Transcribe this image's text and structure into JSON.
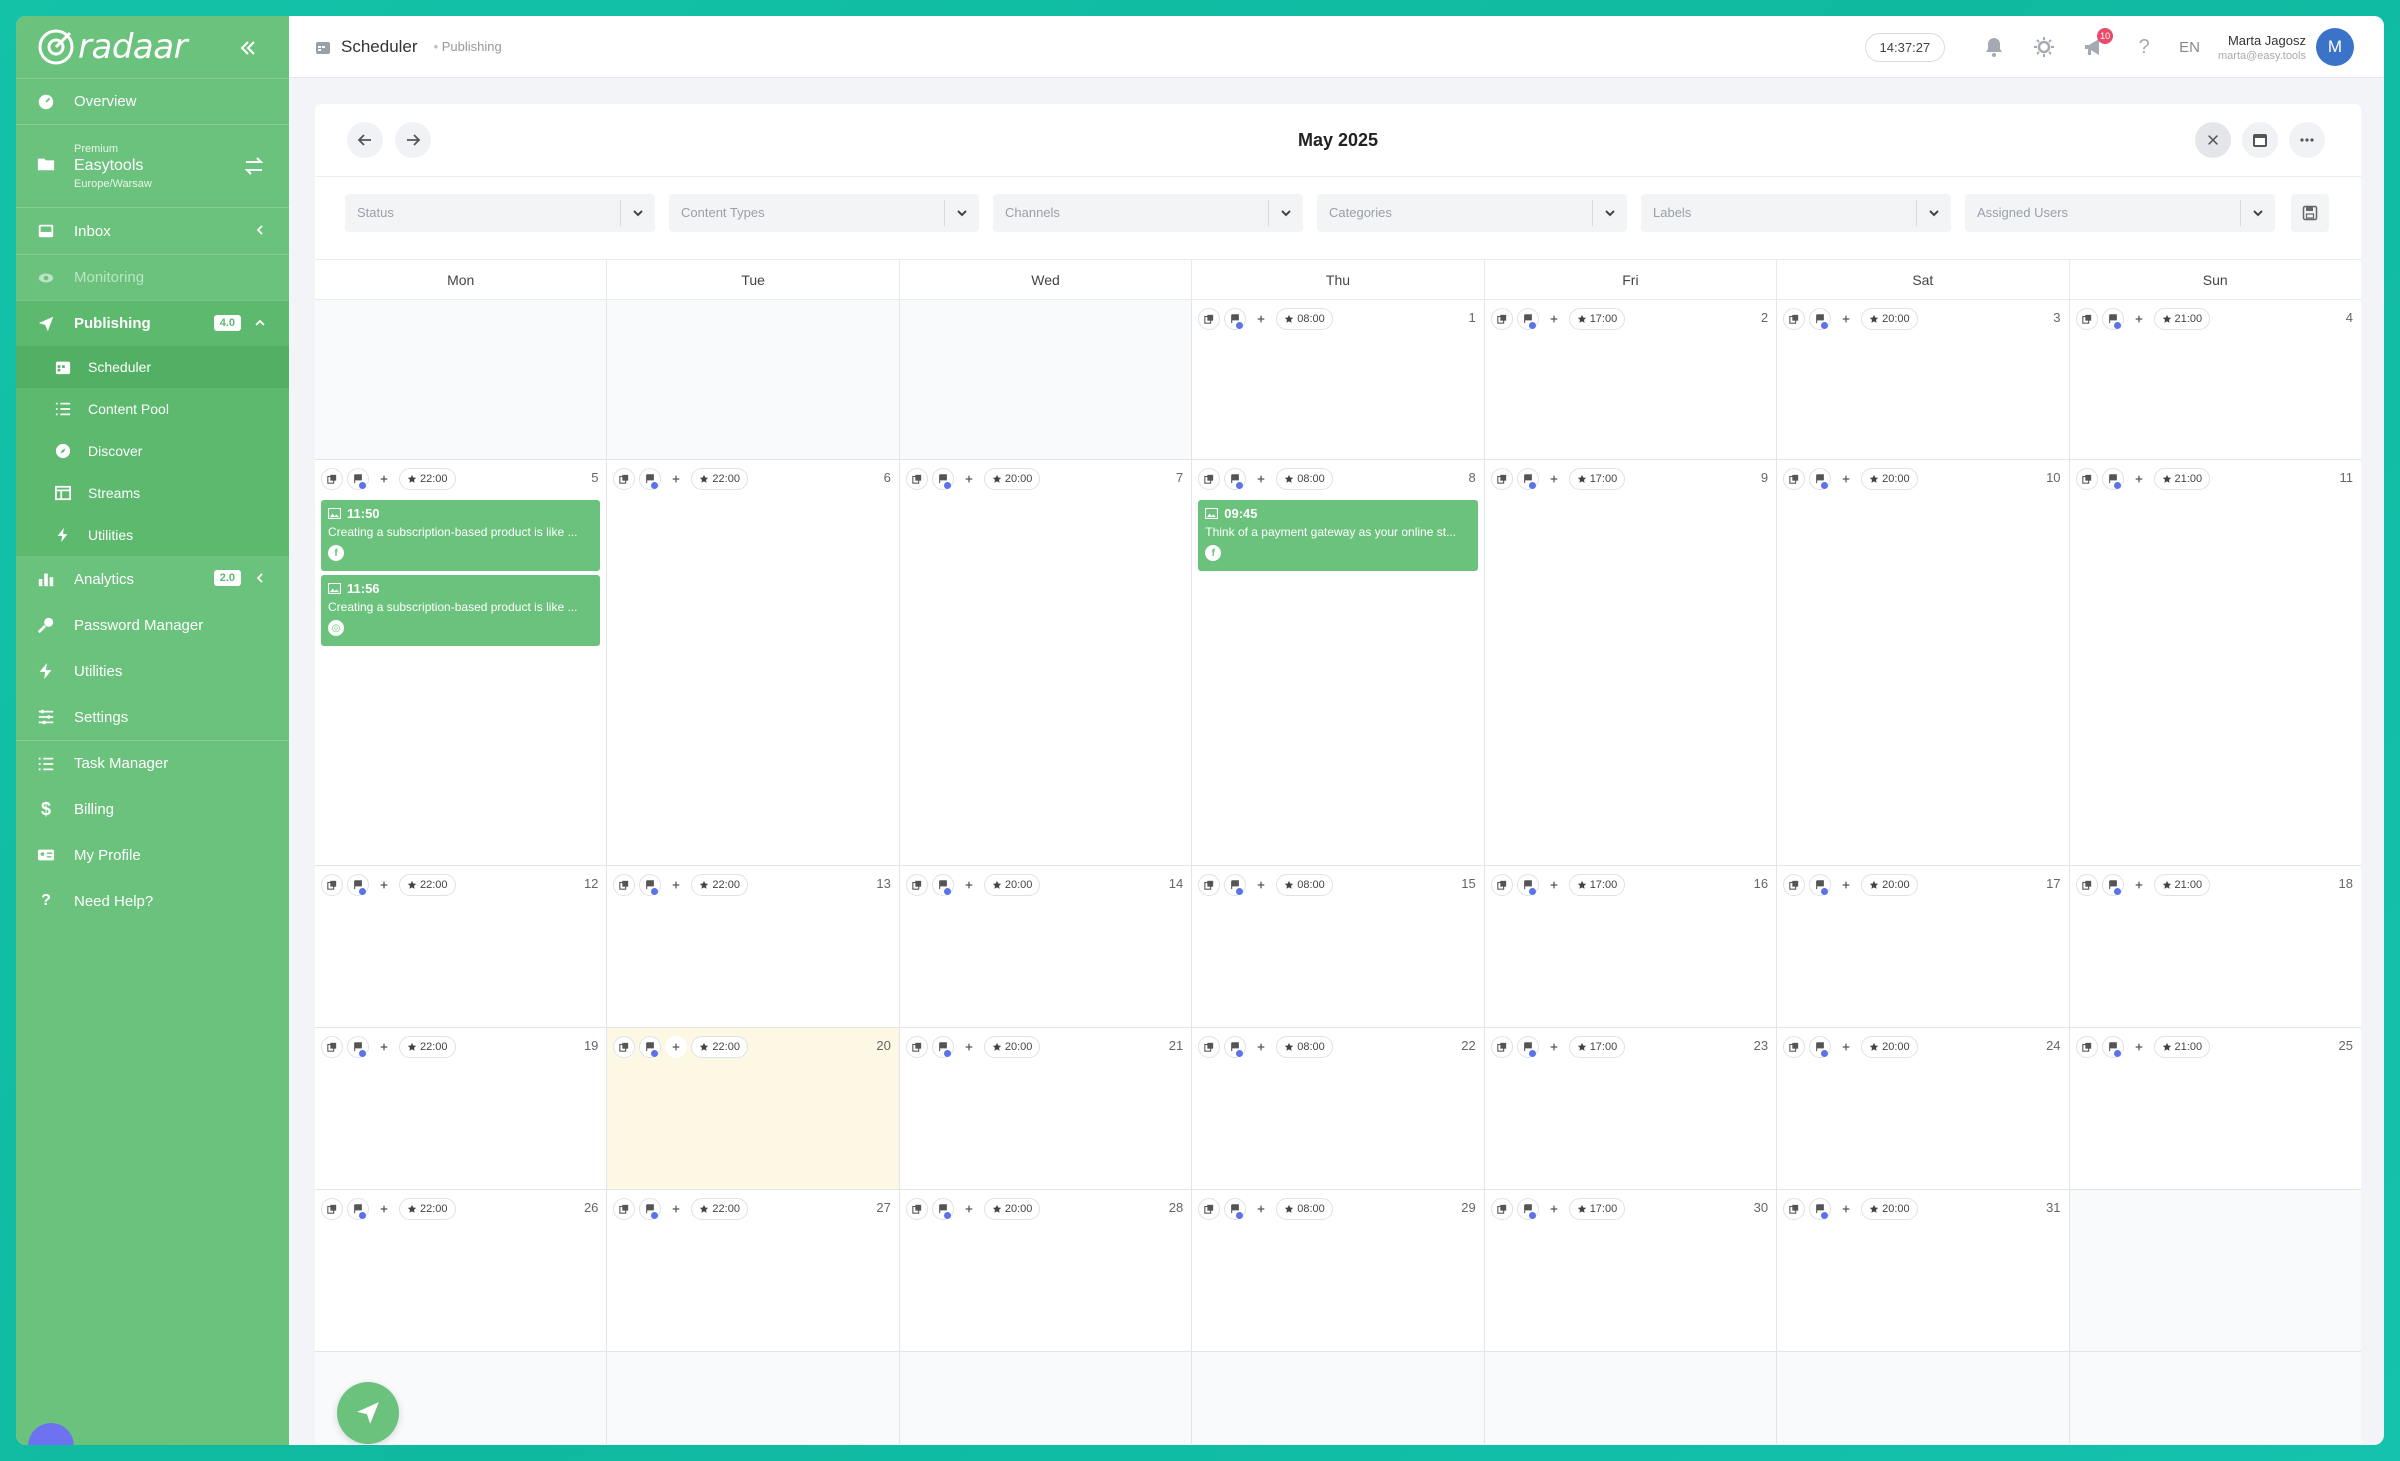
{
  "sidebar": {
    "logo": "radaar",
    "overview": "Overview",
    "workspace": {
      "tier": "Premium",
      "name": "Easytools",
      "tz": "Europe/Warsaw"
    },
    "inbox": "Inbox",
    "monitoring": "Monitoring",
    "publishing": {
      "label": "Publishing",
      "badge": "4.0"
    },
    "publishing_sub": [
      "Scheduler",
      "Content Pool",
      "Discover",
      "Streams",
      "Utilities"
    ],
    "analytics": {
      "label": "Analytics",
      "badge": "2.0"
    },
    "password_manager": "Password Manager",
    "utilities": "Utilities",
    "settings": "Settings",
    "task_manager": "Task Manager",
    "billing": "Billing",
    "my_profile": "My Profile",
    "need_help": "Need Help?"
  },
  "topbar": {
    "title": "Scheduler",
    "breadcrumb": "Publishing",
    "clock": "14:37:27",
    "notifications_badge": "10",
    "lang": "EN",
    "user_name": "Marta Jagosz",
    "user_email": "marta@easy.tools",
    "avatar_initial": "M"
  },
  "calendar": {
    "month": "May 2025",
    "filters": [
      "Status",
      "Content Types",
      "Channels",
      "Categories",
      "Labels",
      "Assigned Users"
    ],
    "weekdays": [
      "Mon",
      "Tue",
      "Wed",
      "Thu",
      "Fri",
      "Sat",
      "Sun"
    ],
    "slot_times": [
      "22:00",
      "22:00",
      "20:00",
      "08:00",
      "17:00",
      "20:00",
      "21:00"
    ],
    "weeks": [
      {
        "height": 160,
        "days": [
          "",
          "",
          "",
          "1",
          "2",
          "3",
          "4"
        ]
      },
      {
        "height": 406,
        "days": [
          "5",
          "6",
          "7",
          "8",
          "9",
          "10",
          "11"
        ]
      },
      {
        "height": 162,
        "days": [
          "12",
          "13",
          "14",
          "15",
          "16",
          "17",
          "18"
        ]
      },
      {
        "height": 162,
        "days": [
          "19",
          "20",
          "21",
          "22",
          "23",
          "24",
          "25"
        ]
      },
      {
        "height": 162,
        "days": [
          "26",
          "27",
          "28",
          "29",
          "30",
          "31",
          ""
        ]
      },
      {
        "height": 120,
        "days": [
          "",
          "",
          "",
          "",
          "",
          "",
          ""
        ]
      }
    ],
    "today": "20",
    "posts": [
      {
        "week": 1,
        "col": 0,
        "slot": 0,
        "time": "11:50",
        "text": "Creating a subscription-based product is like ...",
        "network": "f"
      },
      {
        "week": 1,
        "col": 0,
        "slot": 1,
        "time": "11:56",
        "text": "Creating a subscription-based product is like ...",
        "network": "ig"
      },
      {
        "week": 1,
        "col": 3,
        "slot": 0,
        "time": "09:45",
        "text": "Think of a payment gateway as your online st...",
        "network": "f"
      }
    ]
  }
}
